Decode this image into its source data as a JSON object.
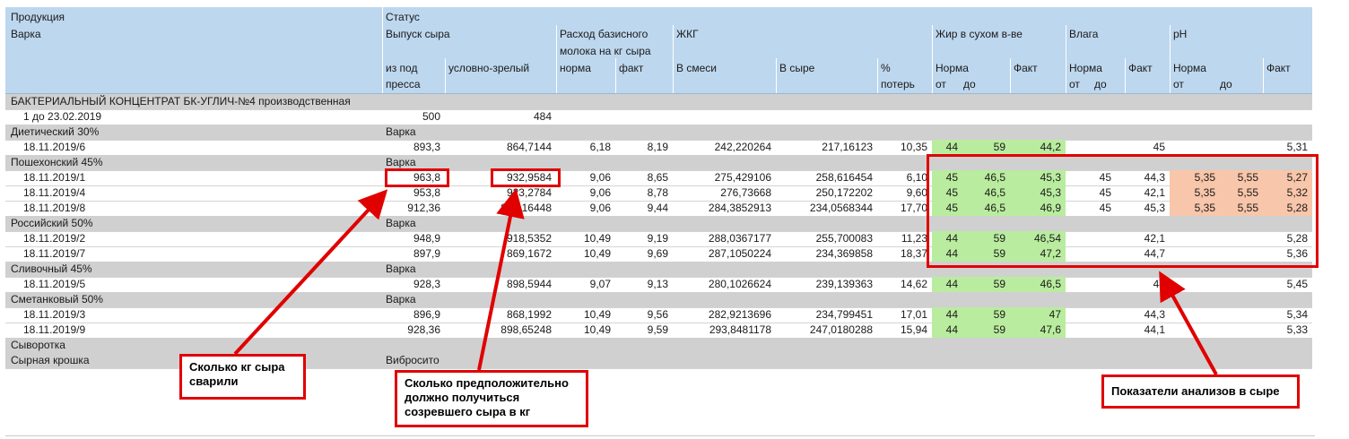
{
  "header": {
    "product": "Продукция",
    "batch": "Варка",
    "status": "Статус",
    "cheese_output": "Выпуск сыра",
    "from_press_1": "из под",
    "from_press_2": "пресса",
    "conditionally_ripe": "условно-зрелый",
    "milk_usage_1": "Расход базисного",
    "milk_usage_2": "молока на кг сыра",
    "norm": "норма",
    "fact": "факт",
    "zhkg": "ЖКГ",
    "in_mix": "В смеси",
    "in_cheese": "В сыре",
    "pct_1": "%",
    "pct_2": "потерь",
    "fat_dry": "Жир в сухом в-ве",
    "norma": "Норма",
    "fakt": "Факт",
    "from": "от",
    "to": "до",
    "moisture": "Влага",
    "ph": "pH"
  },
  "rows": [
    {
      "type": "group",
      "name": "БАКТЕРИАЛЬНЫЙ КОНЦЕНТРАТ БК-УГЛИЧ-№4 производственная",
      "status": ""
    },
    {
      "type": "item",
      "name": "1 до 23.02.2019",
      "press": "500",
      "ripe": "484",
      "mn": "",
      "mf": "",
      "mix": "",
      "cheese": "",
      "loss": "",
      "fatFrom": "",
      "fatTo": "",
      "fatFact": "",
      "wFrom": "",
      "wTo": "",
      "wFact": "",
      "phFrom": "",
      "phTo": "",
      "phFact": "",
      "fatColor": "",
      "phColor": ""
    },
    {
      "type": "group",
      "name": "Диетический 30%",
      "status": "Варка"
    },
    {
      "type": "item",
      "name": "18.11.2019/6",
      "press": "893,3",
      "ripe": "864,7144",
      "mn": "6,18",
      "mf": "8,19",
      "mix": "242,220264",
      "cheese": "217,16123",
      "loss": "10,35",
      "fatFrom": "44",
      "fatTo": "59",
      "fatFact": "44,2",
      "wFrom": "",
      "wTo": "",
      "wFact": "45",
      "phFrom": "",
      "phTo": "",
      "phFact": "5,31",
      "fatColor": "gr",
      "phColor": ""
    },
    {
      "type": "group",
      "name": "Пошехонский 45%",
      "status": "Варка"
    },
    {
      "type": "item",
      "name": "18.11.2019/1",
      "press": "963,8",
      "ripe": "932,9584",
      "mn": "9,06",
      "mf": "8,65",
      "mix": "275,429106",
      "cheese": "258,616454",
      "loss": "6,10",
      "fatFrom": "45",
      "fatTo": "46,5",
      "fatFact": "45,3",
      "wFrom": "45",
      "wTo": "",
      "wFact": "44,3",
      "phFrom": "5,35",
      "phTo": "5,55",
      "phFact": "5,27",
      "fatColor": "gr",
      "phColor": "pk"
    },
    {
      "type": "item",
      "name": "18.11.2019/4",
      "press": "953,8",
      "ripe": "923,2784",
      "mn": "9,06",
      "mf": "8,78",
      "mix": "276,73668",
      "cheese": "250,172202",
      "loss": "9,60",
      "fatFrom": "45",
      "fatTo": "46,5",
      "fatFact": "45,3",
      "wFrom": "45",
      "wTo": "",
      "wFact": "42,1",
      "phFrom": "5,35",
      "phTo": "5,55",
      "phFact": "5,32",
      "fatColor": "gr",
      "phColor": "pk"
    },
    {
      "type": "item",
      "name": "18.11.2019/8",
      "press": "912,36",
      "ripe": "883,16448",
      "mn": "9,06",
      "mf": "9,44",
      "mix": "284,3852913",
      "cheese": "234,0568344",
      "loss": "17,70",
      "fatFrom": "45",
      "fatTo": "46,5",
      "fatFact": "46,9",
      "wFrom": "45",
      "wTo": "",
      "wFact": "45,3",
      "phFrom": "5,35",
      "phTo": "5,55",
      "phFact": "5,28",
      "fatColor": "gr",
      "phColor": "pk"
    },
    {
      "type": "group",
      "name": "Российский 50%",
      "status": "Варка"
    },
    {
      "type": "item",
      "name": "18.11.2019/2",
      "press": "948,9",
      "ripe": "918,5352",
      "mn": "10,49",
      "mf": "9,19",
      "mix": "288,0367177",
      "cheese": "255,700083",
      "loss": "11,23",
      "fatFrom": "44",
      "fatTo": "59",
      "fatFact": "46,54",
      "wFrom": "",
      "wTo": "",
      "wFact": "42,1",
      "phFrom": "",
      "phTo": "",
      "phFact": "5,28",
      "fatColor": "gr",
      "phColor": ""
    },
    {
      "type": "item",
      "name": "18.11.2019/7",
      "press": "897,9",
      "ripe": "869,1672",
      "mn": "10,49",
      "mf": "9,69",
      "mix": "287,1050224",
      "cheese": "234,369858",
      "loss": "18,37",
      "fatFrom": "44",
      "fatTo": "59",
      "fatFact": "47,2",
      "wFrom": "",
      "wTo": "",
      "wFact": "44,7",
      "phFrom": "",
      "phTo": "",
      "phFact": "5,36",
      "fatColor": "gr",
      "phColor": ""
    },
    {
      "type": "group",
      "name": "Сливочный 45%",
      "status": "Варка"
    },
    {
      "type": "item",
      "name": "18.11.2019/5",
      "press": "928,3",
      "ripe": "898,5944",
      "mn": "9,07",
      "mf": "9,13",
      "mix": "280,1026624",
      "cheese": "239,139363",
      "loss": "14,62",
      "fatFrom": "44",
      "fatTo": "59",
      "fatFact": "46,5",
      "wFrom": "",
      "wTo": "",
      "wFact": "44",
      "phFrom": "",
      "phTo": "",
      "phFact": "5,45",
      "fatColor": "gr",
      "phColor": ""
    },
    {
      "type": "group",
      "name": "Сметанковый 50%",
      "status": "Варка"
    },
    {
      "type": "item",
      "name": "18.11.2019/3",
      "press": "896,9",
      "ripe": "868,1992",
      "mn": "10,49",
      "mf": "9,56",
      "mix": "282,9213696",
      "cheese": "234,799451",
      "loss": "17,01",
      "fatFrom": "44",
      "fatTo": "59",
      "fatFact": "47",
      "wFrom": "",
      "wTo": "",
      "wFact": "44,3",
      "phFrom": "",
      "phTo": "",
      "phFact": "5,34",
      "fatColor": "gr",
      "phColor": ""
    },
    {
      "type": "item",
      "name": "18.11.2019/9",
      "press": "928,36",
      "ripe": "898,65248",
      "mn": "10,49",
      "mf": "9,59",
      "mix": "293,8481178",
      "cheese": "247,0180288",
      "loss": "15,94",
      "fatFrom": "44",
      "fatTo": "59",
      "fatFact": "47,6",
      "wFrom": "",
      "wTo": "",
      "wFact": "44,1",
      "phFrom": "",
      "phTo": "",
      "phFact": "5,33",
      "fatColor": "gr",
      "phColor": ""
    },
    {
      "type": "group",
      "name": "Сыворотка",
      "status": ""
    },
    {
      "type": "group",
      "name": "Сырная крошка",
      "status": "Вибросито"
    }
  ],
  "annotations": {
    "cooked": "Сколько кг сыра\nсварили",
    "expected": "Сколько предположительно\nдолжно получиться\nсозревшего сыра в кг",
    "analysis": "Показатели анализов в сыре"
  },
  "colors": {
    "header": "#bdd7ee",
    "group": "#d0d0d0",
    "green": "#b9ec9f",
    "pink": "#f8c6aa",
    "annotation": "#e00000"
  }
}
